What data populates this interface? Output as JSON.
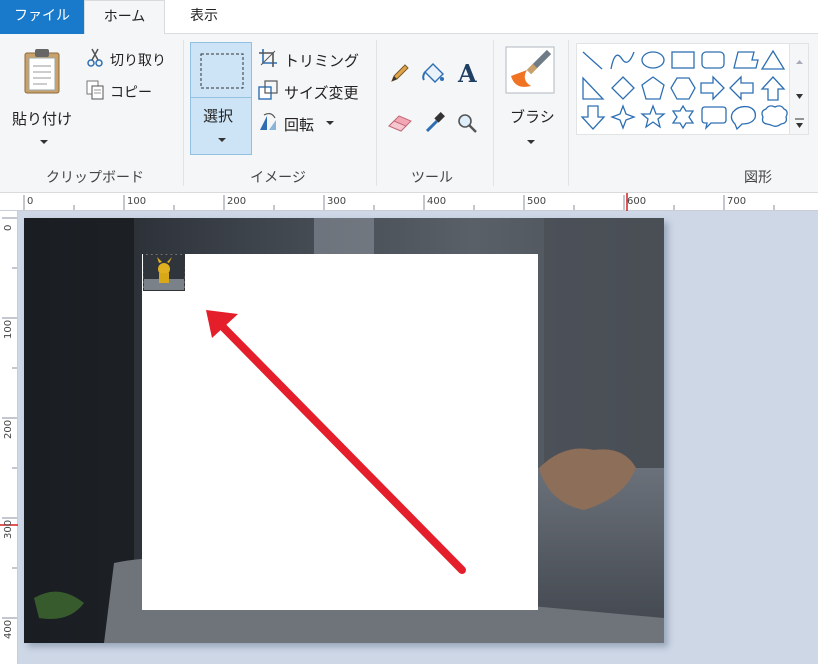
{
  "tabs": {
    "file": "ファイル",
    "home": "ホーム",
    "view": "表示"
  },
  "clipboard": {
    "paste": "貼り付け",
    "cut": "切り取り",
    "copy": "コピー",
    "group": "クリップボード"
  },
  "image": {
    "select": "選択",
    "crop": "トリミング",
    "resize": "サイズ変更",
    "rotate": "回転",
    "group": "イメージ"
  },
  "tools": {
    "group": "ツール",
    "icons": [
      "pencil-icon",
      "fill-bucket-icon",
      "text-icon",
      "eraser-icon",
      "color-picker-icon",
      "magnifier-icon"
    ]
  },
  "brush": {
    "label": "ブラシ"
  },
  "shapes": {
    "group": "図形",
    "items": [
      "line",
      "curve",
      "oval",
      "rectangle",
      "rounded-rectangle",
      "polygon",
      "triangle",
      "right-triangle",
      "diamond",
      "pentagon",
      "hexagon",
      "right-arrow",
      "left-arrow",
      "up-arrow",
      "down-arrow",
      "four-point-star",
      "five-point-star",
      "six-point-star",
      "rounded-rectangle-callout",
      "oval-callout",
      "cloud-callout"
    ]
  },
  "ruler": {
    "top": [
      "0",
      "100",
      "200",
      "300",
      "400",
      "500",
      "600",
      "700"
    ],
    "left": [
      "0",
      "100",
      "200",
      "300",
      "400"
    ]
  },
  "colors": {
    "accent": "#1979ca",
    "arrow": "#e41e2b",
    "selection": "#cde4f7"
  }
}
